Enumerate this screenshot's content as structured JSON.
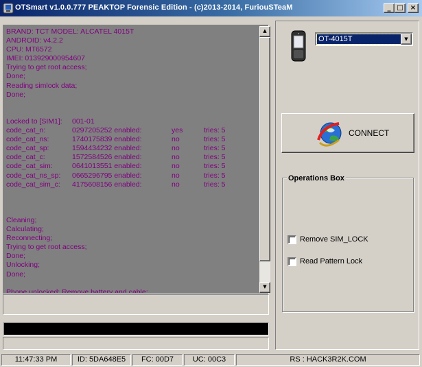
{
  "window": {
    "title": "OTSmart  v1.0.0.777 PEAKTOP Forensic Edition - (c)2013-2014, FuriouSTeaM",
    "minimize": "_",
    "maximize": "□",
    "close": "×"
  },
  "log": {
    "text_color": "#800080",
    "background": "#808080",
    "lines": [
      "BRAND: TCT MODEL: ALCATEL 4015T",
      "ANDROID: v4.2.2",
      "CPU: MT6572",
      "IMEI: 013929000954607",
      "Trying to get root access;",
      "Done;",
      "Reading simlock data;",
      "Done;",
      "",
      "",
      "Locked to [SIM1]:",
      "code_cat_n:",
      "code_cat_ns:",
      "code_cat_sp:",
      "code_cat_c:",
      "code_cat_sim:",
      "code_cat_ns_sp:",
      "code_cat_sim_c:",
      "",
      "",
      "",
      "Cleaning;",
      "Calculating;",
      "Reconnecting;",
      "Trying to get root access;",
      "Done;",
      "Unlocking;",
      "Done;",
      "",
      "Phone unlocked; Remove battery and cable;"
    ],
    "lock_table": {
      "header_value": "001-01",
      "rows": [
        {
          "code": "0297205252 enabled:",
          "flag": "yes",
          "tries": "tries: 5"
        },
        {
          "code": "1740175839 enabled:",
          "flag": "no",
          "tries": "tries: 5"
        },
        {
          "code": "1594434232 enabled:",
          "flag": "no",
          "tries": "tries: 5"
        },
        {
          "code": "1572584526 enabled:",
          "flag": "no",
          "tries": "tries: 5"
        },
        {
          "code": "0641013551 enabled:",
          "flag": "no",
          "tries": "tries: 5"
        },
        {
          "code": "0665296795 enabled:",
          "flag": "no",
          "tries": "tries: 5"
        },
        {
          "code": "4175608156 enabled:",
          "flag": "no",
          "tries": "tries: 5"
        }
      ]
    }
  },
  "scrollbar": {
    "up": "▲",
    "down": "▼"
  },
  "device": {
    "selected": "OT-4015T",
    "arrow": "▼",
    "icon": "phone-icon"
  },
  "connect": {
    "label": "CONNECT",
    "icon": "globe-connect-icon"
  },
  "operations": {
    "title": "Operations Box",
    "options": [
      {
        "label": "Remove SIM_LOCK",
        "checked": false
      },
      {
        "label": "Read Pattern Lock",
        "checked": false
      }
    ]
  },
  "status": {
    "time": "11:47:33 PM",
    "id": "ID: 5DA648E5",
    "fc": "FC: 00D7",
    "uc": "UC: 00C3",
    "rs": "RS : HACK3R2K.COM"
  }
}
